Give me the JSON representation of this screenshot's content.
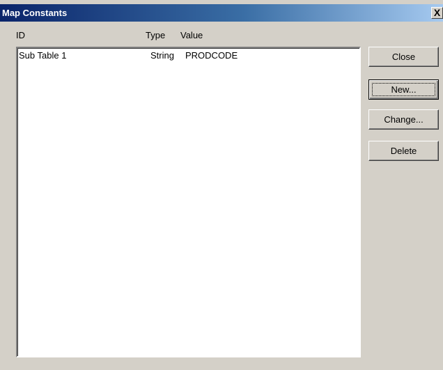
{
  "window": {
    "title": "Map Constants",
    "close_glyph": "X"
  },
  "columns": {
    "id": "ID",
    "type": "Type",
    "value": "Value"
  },
  "rows": [
    {
      "id": "Sub Table 1",
      "type": "String",
      "value": "PRODCODE"
    }
  ],
  "buttons": {
    "close": "Close",
    "new": "New...",
    "change": "Change...",
    "delete": "Delete"
  },
  "colors": {
    "title_bar_start": "#0a246a",
    "title_bar_end": "#a6caf0",
    "dialog_face": "#d4d0c8"
  }
}
